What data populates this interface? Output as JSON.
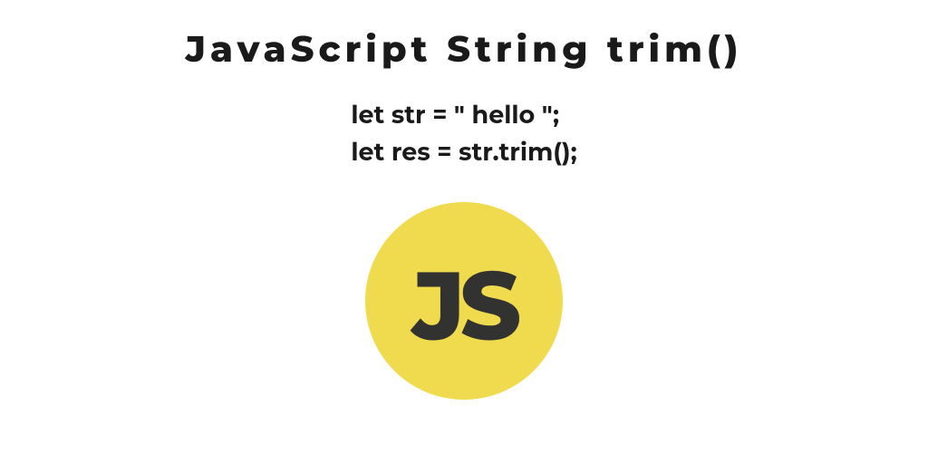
{
  "title": "JavaScript String trim()",
  "code": {
    "line1": "let str = \" hello \";",
    "line2": "let res = str.trim();"
  },
  "badge": {
    "text": "JS",
    "bg_color": "#f0db4f",
    "text_color": "#323330"
  }
}
